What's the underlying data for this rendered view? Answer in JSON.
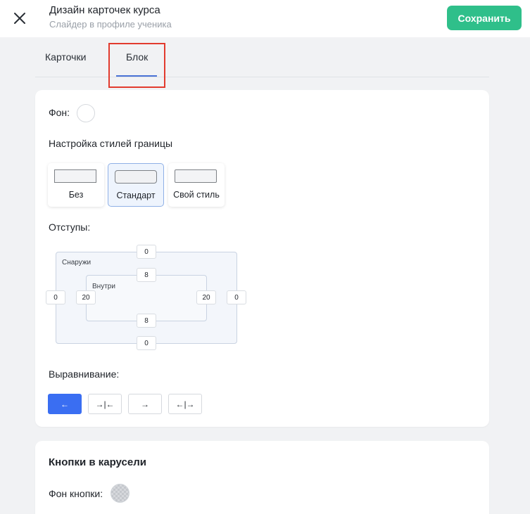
{
  "header": {
    "title": "Дизайн карточек курса",
    "subtitle": "Слайдер в профиле ученика",
    "save_label": "Сохранить",
    "close_icon": "close-icon"
  },
  "tabs": [
    {
      "label": "Карточки",
      "active": false
    },
    {
      "label": "Блок",
      "active": true
    }
  ],
  "block": {
    "background_label": "Фон:",
    "background_color": "#ffffff",
    "border_styles_label": "Настройка стилей границы",
    "border_styles": [
      {
        "label": "Без",
        "selected": false
      },
      {
        "label": "Стандарт",
        "selected": true
      },
      {
        "label": "Свой стиль",
        "selected": false
      }
    ],
    "padding_label": "Отступы:",
    "outer_label": "Снаружи",
    "inner_label": "Внутри",
    "outer": {
      "top": "0",
      "left": "0",
      "right": "0",
      "bottom": "0"
    },
    "inner": {
      "top": "8",
      "left": "20",
      "right": "20",
      "bottom": "8"
    },
    "alignment_label": "Выравнивание:",
    "alignment_options": [
      {
        "icon": "arrow-left-icon",
        "glyph": "←",
        "active": true
      },
      {
        "icon": "align-center-icon",
        "glyph": "→|←",
        "active": false
      },
      {
        "icon": "arrow-right-icon",
        "glyph": "→",
        "active": false
      },
      {
        "icon": "align-stretch-icon",
        "glyph": "←|→",
        "active": false
      }
    ]
  },
  "carousel": {
    "title": "Кнопки в карусели",
    "button_bg_label": "Фон кнопки:"
  },
  "colors": {
    "accent": "#3a6ef2",
    "save": "#2fbf8a",
    "highlight": "#e23b2e"
  }
}
